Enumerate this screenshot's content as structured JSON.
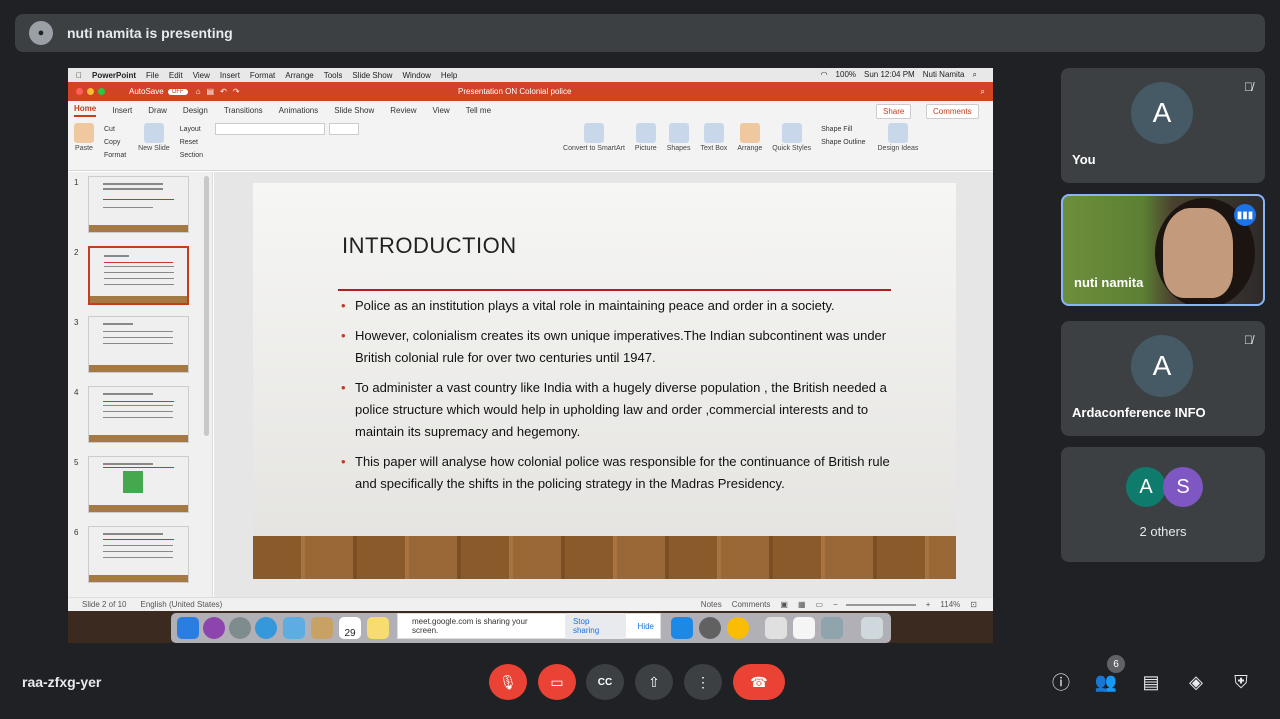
{
  "header": {
    "presenter_text": "nuti namita is presenting"
  },
  "mac_menu": {
    "app": "PowerPoint",
    "items": [
      "File",
      "Edit",
      "View",
      "Insert",
      "Format",
      "Arrange",
      "Tools",
      "Slide Show",
      "Window",
      "Help"
    ],
    "status": [
      "100%",
      "Sun 12:04 PM",
      "Nuti Namita"
    ]
  },
  "ppt": {
    "autosave": "AutoSave",
    "autosave_state": "OFF",
    "doc_title": "Presentation ON Colonial police",
    "tabs": [
      "Home",
      "Insert",
      "Draw",
      "Design",
      "Transitions",
      "Animations",
      "Slide Show",
      "Review",
      "View",
      "Tell me"
    ],
    "share": "Share",
    "comments": "Comments",
    "tools": {
      "paste": "Paste",
      "cut": "Cut",
      "copy": "Copy",
      "format": "Format",
      "new_slide": "New Slide",
      "layout": "Layout",
      "reset": "Reset",
      "section": "Section",
      "convert": "Convert to SmartArt",
      "picture": "Picture",
      "shapes": "Shapes",
      "textbox": "Text Box",
      "arrange": "Arrange",
      "quick_styles": "Quick Styles",
      "shape_fill": "Shape Fill",
      "shape_outline": "Shape Outline",
      "design_ideas": "Design Ideas"
    }
  },
  "thumbnails": [
    "1",
    "2",
    "3",
    "4",
    "5",
    "6"
  ],
  "slide": {
    "title": "INTRODUCTION",
    "bullets": [
      "Police as an institution plays a vital role in maintaining peace and order in a society.",
      "However, colonialism creates its own unique imperatives.The Indian subcontinent was under British colonial rule for over two centuries until 1947.",
      "To administer a vast country like India with a hugely diverse population , the British needed a police structure which would   help in upholding law and order ,commercial interests and to maintain its supremacy and hegemony.",
      "This paper will analyse how colonial police was responsible for the continuance of British rule and specifically the shifts in the policing strategy in the Madras Presidency."
    ]
  },
  "statusbar": {
    "slide_pos": "Slide 2 of 10",
    "language": "English (United States)",
    "notes": "Notes",
    "comments": "Comments",
    "zoom": "114%"
  },
  "dock": {
    "calendar_day": "29"
  },
  "sharebar": {
    "text": "meet.google.com is sharing your screen.",
    "stop": "Stop sharing",
    "hide": "Hide"
  },
  "participants": {
    "you": {
      "initial": "A",
      "name": "You"
    },
    "presenter": {
      "name": "nuti namita"
    },
    "arda": {
      "initial": "A",
      "name": "Ardaconference INFO"
    },
    "others": {
      "initials": [
        "A",
        "S"
      ],
      "label": "2 others"
    }
  },
  "bottom": {
    "meeting_code": "raa-zfxg-yer",
    "people_count": "6"
  },
  "colors": {
    "ppt_accent": "#c43e1c",
    "leave": "#ea4335",
    "avatar_green": "#0f7b6c",
    "avatar_purple": "#7e57c2"
  }
}
